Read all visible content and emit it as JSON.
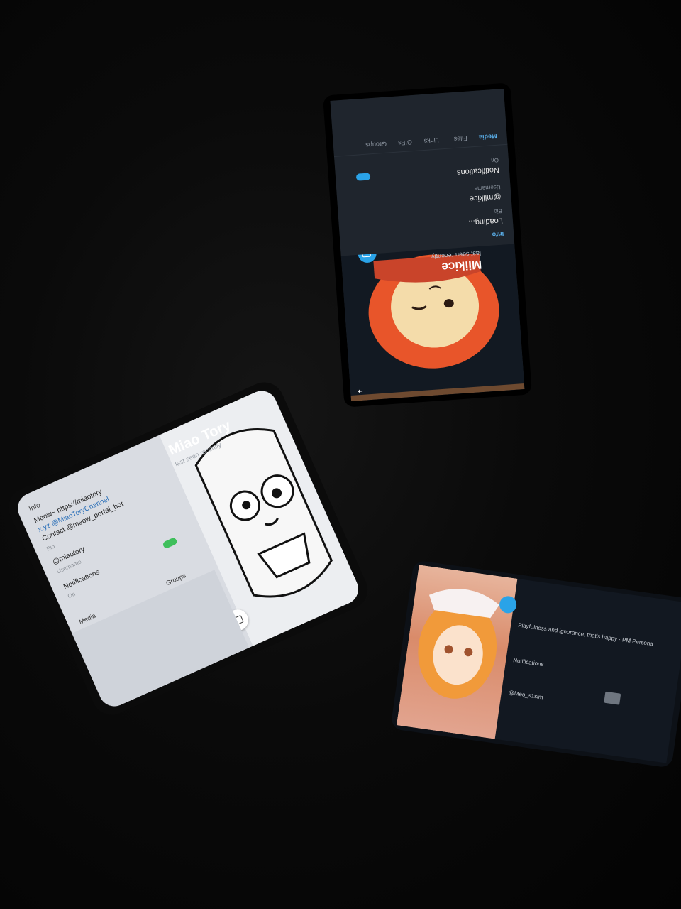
{
  "phone_top": {
    "name": "Miikice",
    "status": "last seen recently",
    "info_heading": "Info",
    "bio_value": "Loading...",
    "bio_label": "Bio",
    "username_value": "@miikice",
    "username_label": "Username",
    "notifications_label": "Notifications",
    "notifications_value": "On",
    "tabs": [
      "Media",
      "Files",
      "Links",
      "GIFs",
      "Groups"
    ]
  },
  "phone_middle": {
    "name": "Miao Tory",
    "status": "last seen recently",
    "info_heading": "Info",
    "bio_lines": [
      "Meow~ https://miaotory",
      "x.yz @MiaoToryChannel",
      "Contact @meow_portal_bot"
    ],
    "bio_label": "Bio",
    "username_value": "@miaotory",
    "username_label": "Username",
    "notifications_label": "Notifications",
    "notifications_value": "On",
    "tabs": [
      "Media",
      "Groups"
    ]
  },
  "phone_bottom": {
    "username_value": "@Meo_s1sim",
    "bio_text": "Playfulness and ignorance, that's happy · PM Persona",
    "notifications_label": "Notifications"
  },
  "colors": {
    "background": "#060606",
    "telegram_blue": "#2aa3e8",
    "switch_green": "#3fbf5b",
    "character_orange": "#e8552a"
  }
}
